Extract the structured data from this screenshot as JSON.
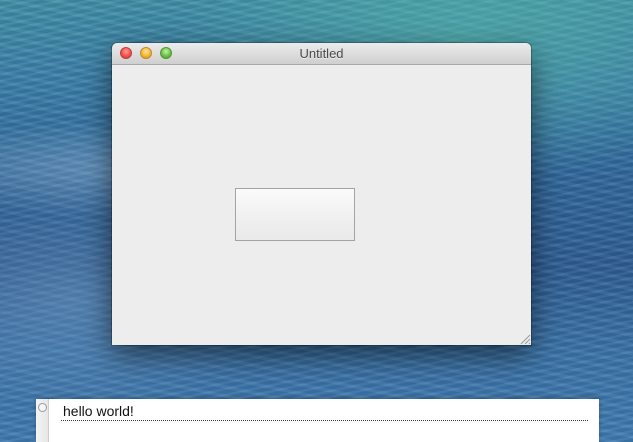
{
  "window": {
    "title": "Untitled",
    "controls": {
      "close_color": "#f0524a",
      "minimize_color": "#f5b532",
      "zoom_color": "#6cc044"
    }
  },
  "content": {
    "button_label": ""
  },
  "text_field": {
    "value": "hello world!"
  },
  "icons": [
    "close-icon",
    "minimize-icon",
    "zoom-icon",
    "resize-grip-icon",
    "radio-icon"
  ]
}
